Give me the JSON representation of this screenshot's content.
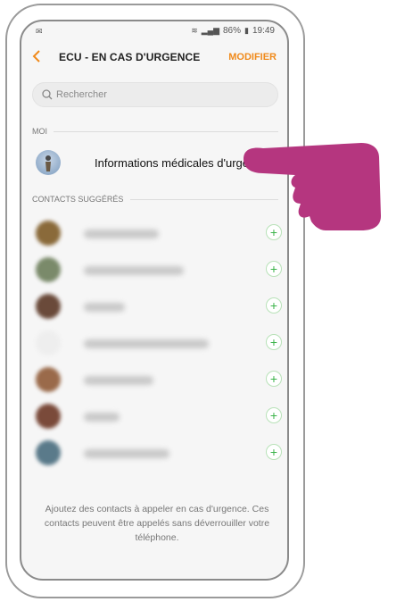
{
  "status": {
    "battery": "86%",
    "time": "19:49"
  },
  "appbar": {
    "back_icon": "chevron-left-icon",
    "title": "ECU - EN CAS D'URGENCE",
    "modify": "MODIFIER"
  },
  "search": {
    "placeholder": "Rechercher"
  },
  "sections": {
    "me": "MOI",
    "suggested": "CONTACTS SUGGÉRÉS"
  },
  "me_item": {
    "label": "Informations médicales d'urgence"
  },
  "contacts_count": 7,
  "footer": {
    "text": "Ajoutez des contacts à appeler en cas d'urgence. Ces contacts peuvent être appelés sans déverrouiller votre téléphone."
  },
  "colors": {
    "accent": "#f08a1b",
    "plus": "#3bb34a",
    "hand": "#b5367f"
  }
}
